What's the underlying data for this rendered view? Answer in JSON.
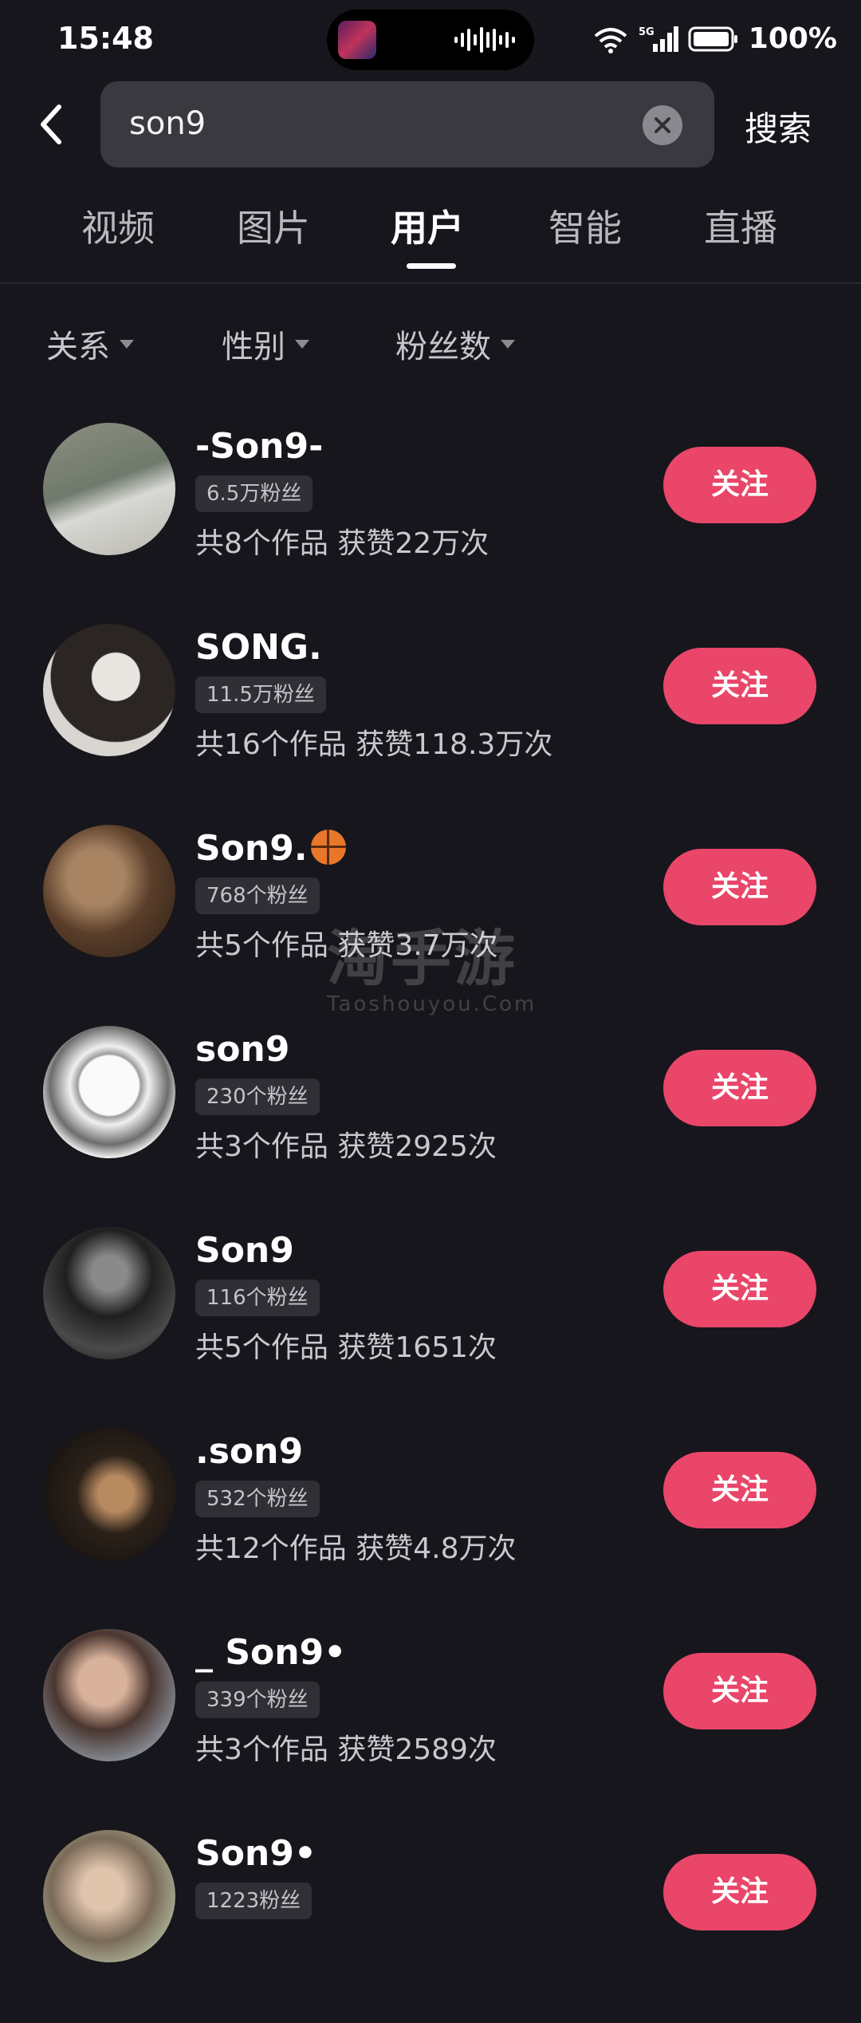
{
  "status_bar": {
    "time": "15:48",
    "battery": "100%",
    "network": "5G"
  },
  "search": {
    "query": "son9",
    "submit_label": "搜索"
  },
  "tabs": [
    {
      "label": "视频"
    },
    {
      "label": "图片"
    },
    {
      "label": "用户",
      "active": true
    },
    {
      "label": "智能"
    },
    {
      "label": "直播"
    }
  ],
  "filters": [
    {
      "label": "关系"
    },
    {
      "label": "性别"
    },
    {
      "label": "粉丝数"
    }
  ],
  "users": [
    {
      "name": "-Son9-",
      "fans": "6.5万粉丝",
      "stats": "共8个作品 获赞22万次",
      "follow": "关注"
    },
    {
      "name": "SONG.",
      "fans": "11.5万粉丝",
      "stats": "共16个作品 获赞118.3万次",
      "follow": "关注"
    },
    {
      "name": "Son9.",
      "emoji": "basketball",
      "fans": "768个粉丝",
      "stats": "共5个作品 获赞3.7万次",
      "follow": "关注"
    },
    {
      "name": "son9",
      "fans": "230个粉丝",
      "stats": "共3个作品 获赞2925次",
      "follow": "关注"
    },
    {
      "name": "Son9",
      "fans": "116个粉丝",
      "stats": "共5个作品 获赞1651次",
      "follow": "关注"
    },
    {
      "name": ".son9",
      "fans": "532个粉丝",
      "stats": "共12个作品 获赞4.8万次",
      "follow": "关注"
    },
    {
      "name": "_ Son9•",
      "fans": "339个粉丝",
      "stats": "共3个作品 获赞2589次",
      "follow": "关注"
    },
    {
      "name": "Son9•",
      "fans": "1223粉丝",
      "stats": "",
      "follow": "关注"
    }
  ],
  "watermark": {
    "title": "淘手游",
    "subtitle": "Taoshouyou.Com"
  },
  "colors": {
    "background": "#17161c",
    "accent": "#e9466a",
    "search_box": "#3a393f"
  }
}
